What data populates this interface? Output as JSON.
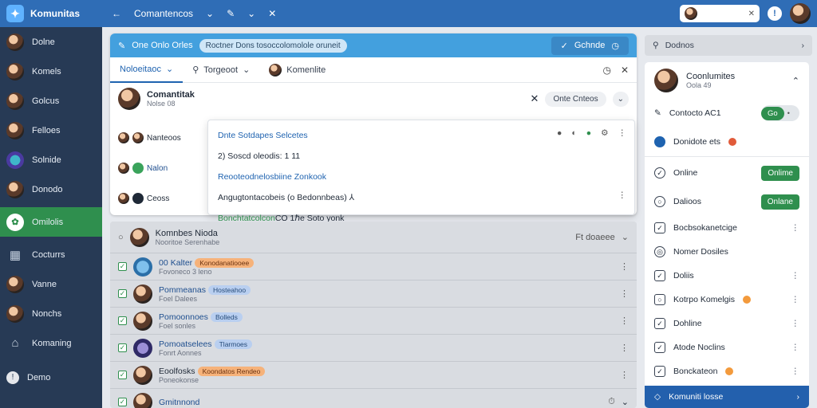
{
  "app": {
    "name": "Komunitas"
  },
  "topbar": {
    "back_icon": "arrow-left-icon",
    "title": "Comantencos",
    "arrow1": "⌄",
    "edit_icon": "pencil-icon",
    "arrow2": "⌄",
    "close_icon": "x-icon"
  },
  "sidebar": {
    "items": [
      {
        "label": "Dolne"
      },
      {
        "label": "Komels"
      },
      {
        "label": "Golcus"
      },
      {
        "label": "Felloes"
      },
      {
        "label": "Solnide"
      },
      {
        "label": "Donodo"
      },
      {
        "label": "Omilolis",
        "active": true
      },
      {
        "label": "Cocturrs"
      },
      {
        "label": "Vanne"
      },
      {
        "label": "Nonchs"
      },
      {
        "label": "Komaning"
      },
      {
        "label": "Demo"
      }
    ]
  },
  "card": {
    "head_label": "One Onlo Orles",
    "head_pill": "Roctner Dons tosoccolomolole oruneit",
    "head_button": "Gchnde",
    "tabs": [
      {
        "label": "Noloeitaoc",
        "active": true
      },
      {
        "label": "Torgeoot"
      },
      {
        "label": "Komenlite"
      }
    ],
    "contact_name": "Comantitak",
    "contact_sub": "Nolse 08",
    "contact_button": "Onte Cnteos",
    "bg_rows": [
      {
        "label": "Nanteoos"
      },
      {
        "label": "Nalon"
      },
      {
        "label": "Ceoss"
      }
    ]
  },
  "popup": {
    "title": "Dnte Sotdapes Selcetes",
    "line2": "2) Soscd oleodis: 1 11",
    "line3": "Reooteodnelosbiine Zonkook",
    "line4": "Angugtontacobeis (o Bedonnbeas) ⅄",
    "line5": "Bonchtatcolcon",
    "line5b": "CO 1ℏe Soto yonk"
  },
  "list": {
    "header_name": "Komnbes Nioda",
    "header_sub": "Nooritoe Serenhabe",
    "header_right": "Ft doaeee",
    "rows": [
      {
        "name": "Kalter",
        "prefix": "00",
        "tag": "Konodanatiooee",
        "tag_color": "orange",
        "sub": "Fovoneco 3 leno"
      },
      {
        "name": "Pommeanas",
        "tag": "Hosteahoo",
        "tag_color": "blue",
        "sub": "Foel Dalees"
      },
      {
        "name": "Pomoonnoes",
        "tag": "Bolleds",
        "tag_color": "blue",
        "sub": "Foel sonles"
      },
      {
        "name": "Pomoatselees",
        "tag": "Tlarmoes",
        "tag_color": "blue",
        "sub": "Fonrt Aonnes"
      },
      {
        "name": "Eoolfosks",
        "tag": "Koondatos Rendeo",
        "tag_color": "orange",
        "sub": "Poneokonse"
      },
      {
        "name": "Gmitnnond",
        "tag": "",
        "tag_color": "",
        "sub": ""
      }
    ]
  },
  "right": {
    "search": "Dodnos",
    "profile_name": "Coonlumites",
    "profile_sub": "Oola 49",
    "items": [
      {
        "label": "Contocto AC1",
        "type": "toggle",
        "value": "Go"
      },
      {
        "label": "Donidote ets",
        "type": "badge"
      },
      {
        "label": "Online",
        "type": "button",
        "value": "Onlime"
      },
      {
        "label": "Dalioos",
        "type": "button",
        "value": "Onlane"
      },
      {
        "label": "Bocbsokanetcige",
        "type": "kebab"
      },
      {
        "label": "Nomer Dosiles",
        "type": "kebab"
      },
      {
        "label": "Doliis",
        "type": "kebab"
      },
      {
        "label": "Kotrpo Komelgis",
        "type": "kebab-badge"
      },
      {
        "label": "Dohline",
        "type": "kebab"
      },
      {
        "label": "Atode Noclins",
        "type": "kebab"
      },
      {
        "label": "Bonckateon",
        "type": "kebab-badge"
      }
    ],
    "footer": "Komuniti losse"
  }
}
